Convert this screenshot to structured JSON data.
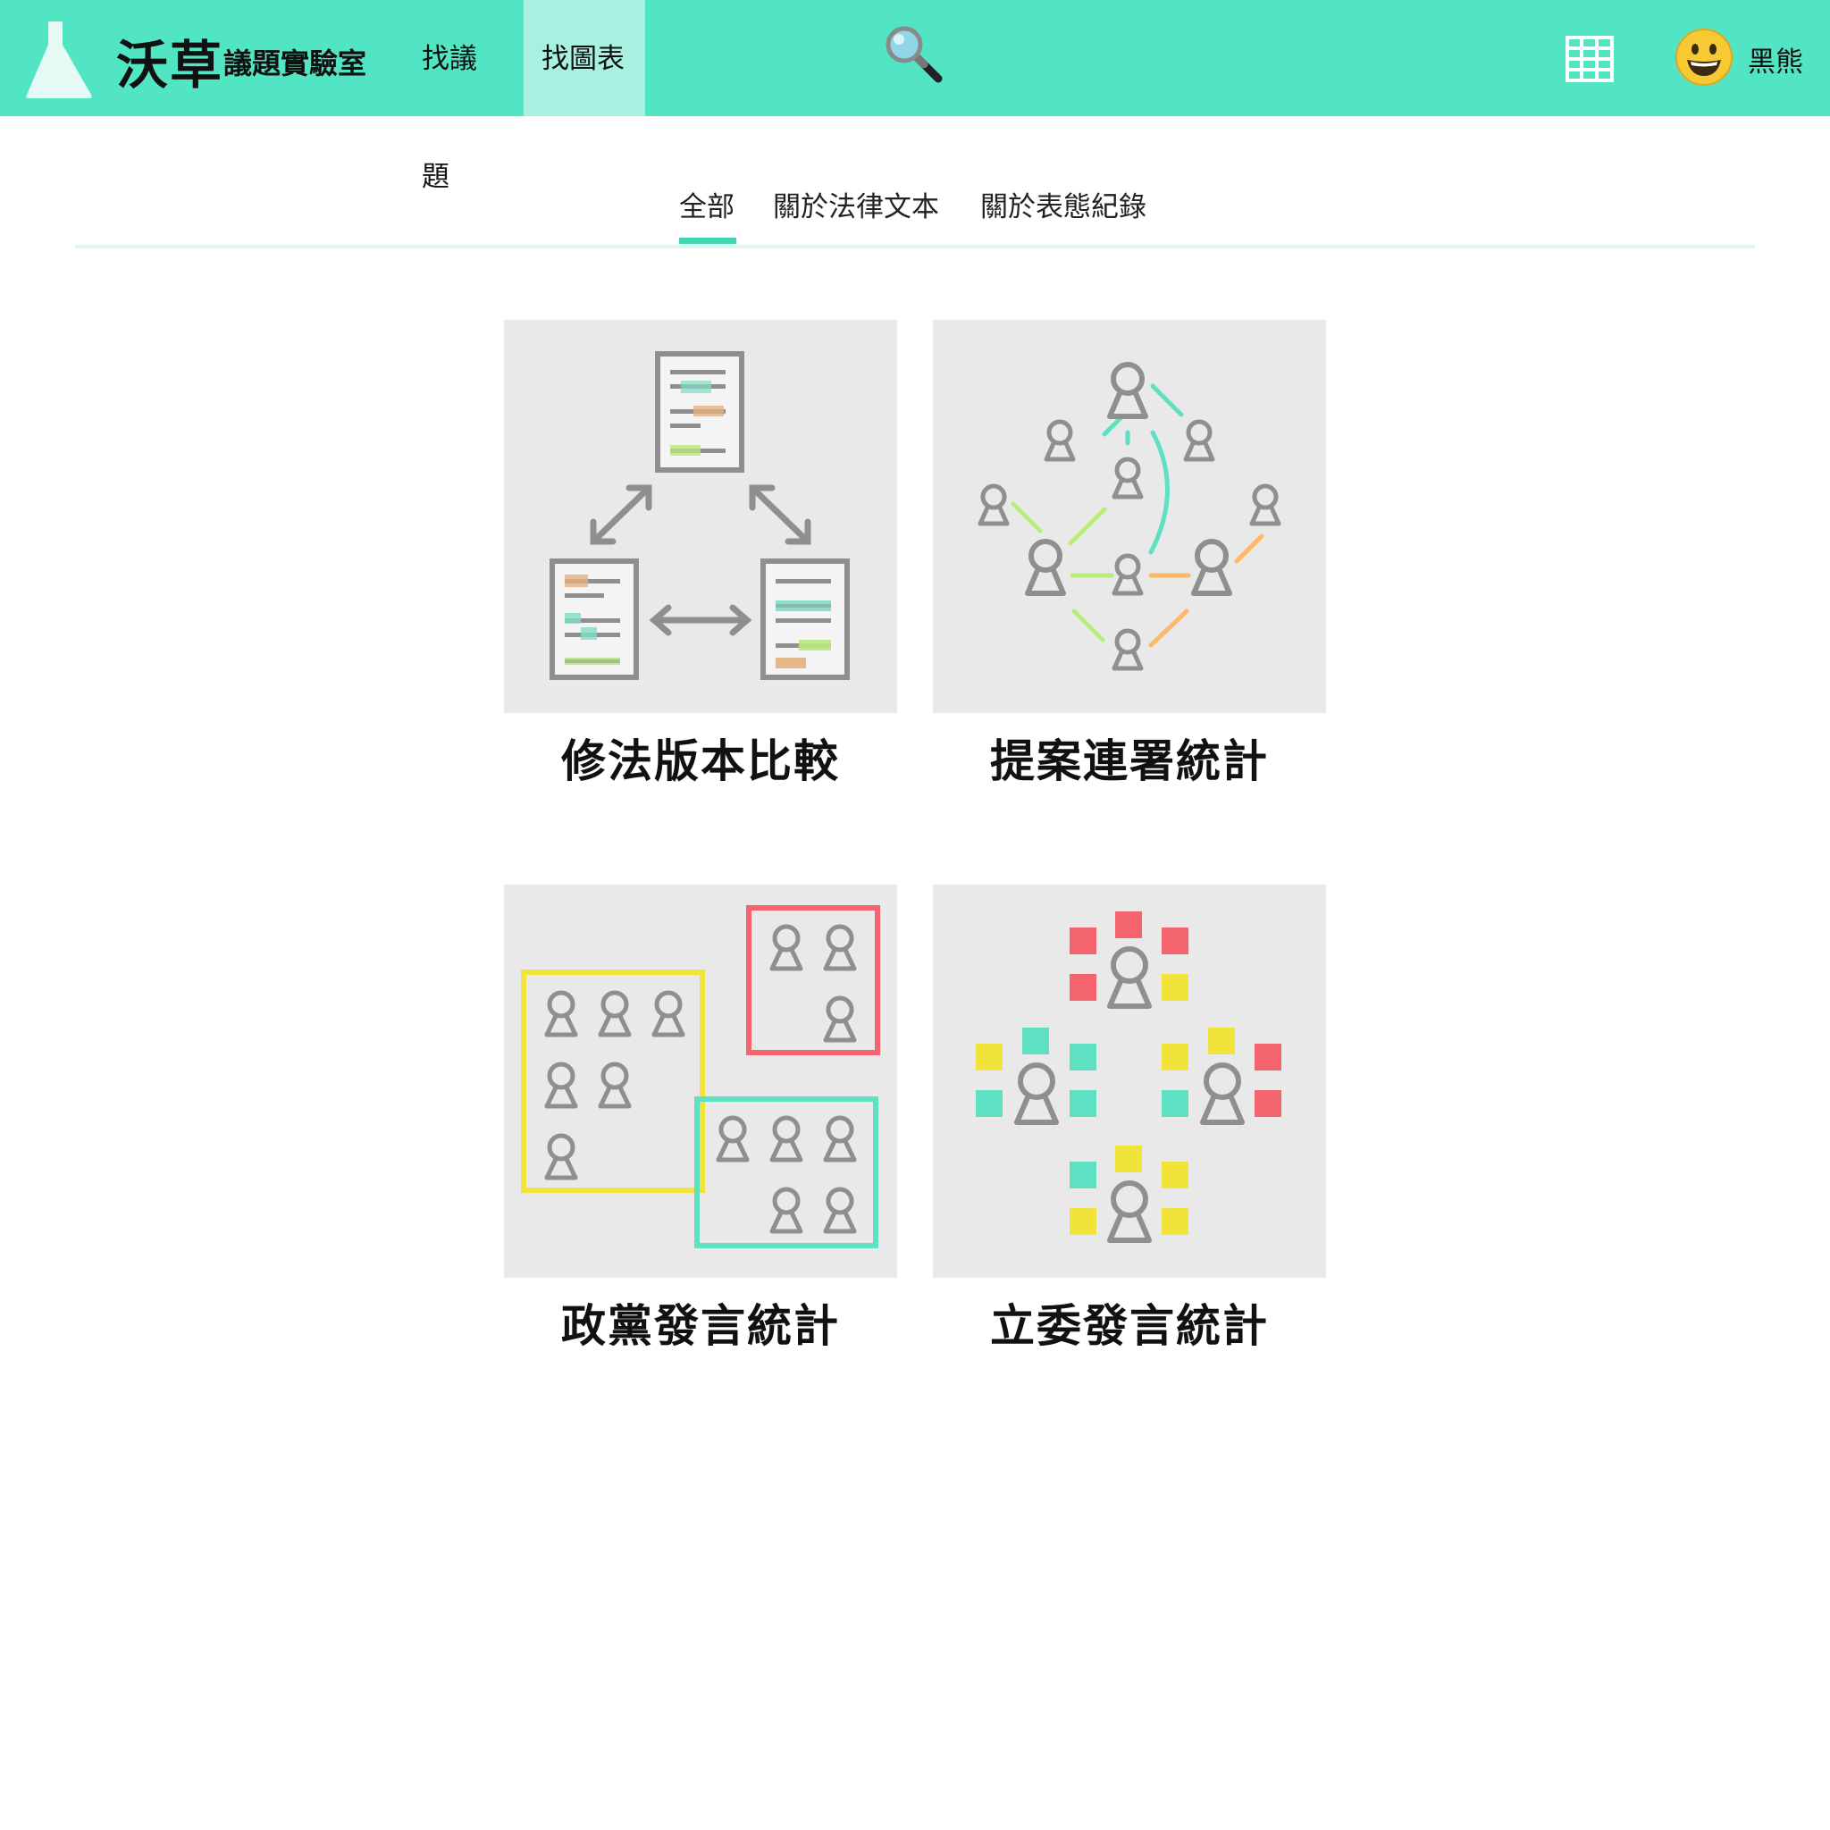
{
  "header": {
    "brand": "沃草",
    "brand_sub": "議題實驗室",
    "nav": [
      {
        "label": "找議題"
      },
      {
        "label": "找圖表",
        "active": true
      }
    ],
    "user_name": "黑熊",
    "accent_color": "#52e5c3"
  },
  "tabs": {
    "items": [
      {
        "label": "全部",
        "active": true
      },
      {
        "label": "關於法律文本"
      },
      {
        "label": "關於表態紀錄"
      }
    ]
  },
  "cards": [
    {
      "title": "修法版本比較",
      "icon": "document-compare-icon"
    },
    {
      "title": "提案連署統計",
      "icon": "network-people-icon"
    },
    {
      "title": "政黨發言統計",
      "icon": "party-groups-icon"
    },
    {
      "title": "立委發言統計",
      "icon": "legislator-squares-icon"
    }
  ]
}
